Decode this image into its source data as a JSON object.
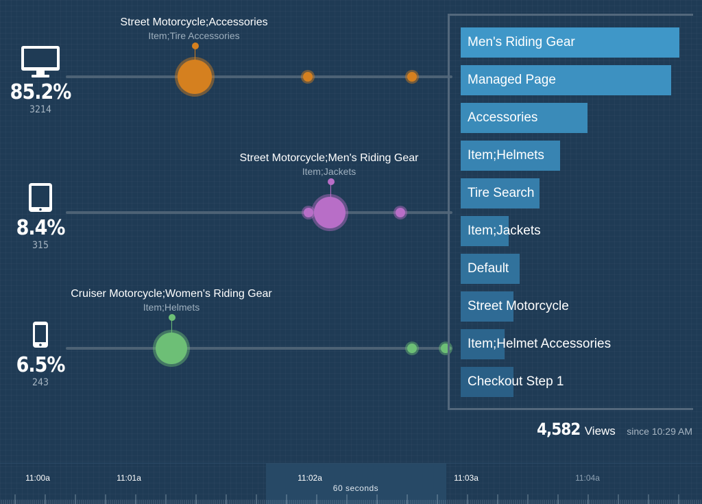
{
  "colors": {
    "desktop": "#d5801f",
    "tablet": "#b86ec7",
    "mobile": "#6dbf76",
    "bar_top": "#3f97c8",
    "bar_bottom": "#2a5f86"
  },
  "devices": [
    {
      "key": "desktop",
      "icon": "desktop-monitor-icon",
      "percent": "85.2%",
      "count": "3214",
      "callout": {
        "title": "Street Motorcycle;Accessories",
        "subtitle": "Item;Tire Accessories"
      }
    },
    {
      "key": "tablet",
      "icon": "tablet-icon",
      "percent": "8.4%",
      "count": "315",
      "callout": {
        "title": "Street Motorcycle;Men's Riding Gear",
        "subtitle": "Item;Jackets"
      }
    },
    {
      "key": "mobile",
      "icon": "smartphone-icon",
      "percent": "6.5%",
      "count": "243",
      "callout": {
        "title": "Cruiser Motorcycle;Women's Riding Gear",
        "subtitle": "Item;Helmets"
      }
    }
  ],
  "top_pages": [
    {
      "label": "Men's Riding Gear",
      "value": 1.0
    },
    {
      "label": "Managed Page",
      "value": 0.962
    },
    {
      "label": "Accessories",
      "value": 0.58
    },
    {
      "label": "Item;Helmets",
      "value": 0.456
    },
    {
      "label": "Tire Search",
      "value": 0.36
    },
    {
      "label": "Item;Jackets",
      "value": 0.22
    },
    {
      "label": "Default",
      "value": 0.27
    },
    {
      "label": "Street Motorcycle",
      "value": 0.24
    },
    {
      "label": "Item;Helmet Accessories",
      "value": 0.2
    },
    {
      "label": "Checkout Step 1",
      "value": 0.24
    }
  ],
  "summary": {
    "views": "4,582",
    "views_label": "Views",
    "since": "since 10:29 AM"
  },
  "timeline": {
    "labels": [
      "11:00a",
      "11:01a",
      "11:02a",
      "11:03a",
      "11:04a"
    ],
    "window_label": "60 seconds"
  }
}
